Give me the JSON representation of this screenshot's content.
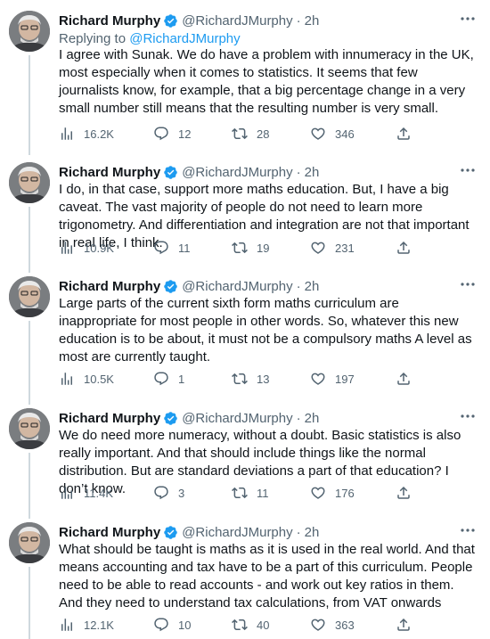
{
  "tweets": [
    {
      "name": "Richard Murphy",
      "handle": "@RichardJMurphy",
      "separator": "·",
      "time": "2h",
      "replying_prefix": "Replying to",
      "replying_to": "@RichardJMurphy",
      "text": "I agree with Sunak. We do have a problem with innumeracy in the UK, most especially when it comes to statistics. It seems that few journalists know, for example, that a big percentage change in a very small number still means that the resulting number is very small.",
      "views": "16.2K",
      "replies": "12",
      "retweets": "28",
      "likes": "346"
    },
    {
      "name": "Richard Murphy",
      "handle": "@RichardJMurphy",
      "separator": "·",
      "time": "2h",
      "text": "I do, in that case, support more maths education. But, I have a big caveat. The vast majority of people do not need to learn more trigonometry. And differentiation and integration are not that important in real life, I think.",
      "views": "10.9K",
      "replies": "11",
      "retweets": "19",
      "likes": "231"
    },
    {
      "name": "Richard Murphy",
      "handle": "@RichardJMurphy",
      "separator": "·",
      "time": "2h",
      "text": "Large parts of the current sixth form maths curriculum are inappropriate for most people in other words. So, whatever this new education is to be about, it must not be a compulsory maths A level as most are currently taught.",
      "views": "10.5K",
      "replies": "1",
      "retweets": "13",
      "likes": "197"
    },
    {
      "name": "Richard Murphy",
      "handle": "@RichardJMurphy",
      "separator": "·",
      "time": "2h",
      "text": "We do need more numeracy, without a doubt. Basic statistics is also really important. And that should include things like the normal distribution. But are standard deviations a part of that education? I don’t know.",
      "views": "11.4K",
      "replies": "3",
      "retweets": "11",
      "likes": "176"
    },
    {
      "name": "Richard Murphy",
      "handle": "@RichardJMurphy",
      "separator": "·",
      "time": "2h",
      "text": "What should be taught is maths as it is used in the real world. And that means accounting and tax have to be a part of this curriculum. People need to be able to read accounts - and work out key ratios in them. And they need to understand tax calculations, from VAT onwards",
      "views": "12.1K",
      "replies": "10",
      "retweets": "40",
      "likes": "363"
    }
  ],
  "colors": {
    "accent": "#1d9bf0",
    "secondary_text": "#536471",
    "primary_text": "#0f1419",
    "thread_line": "#cfd9de",
    "divider": "#eff3f4"
  },
  "icons": {
    "more": "more-dots-icon",
    "verified": "verified-badge-icon",
    "views": "views-chart-icon",
    "reply": "reply-icon",
    "retweet": "retweet-icon",
    "like": "heart-icon",
    "share": "share-icon"
  }
}
